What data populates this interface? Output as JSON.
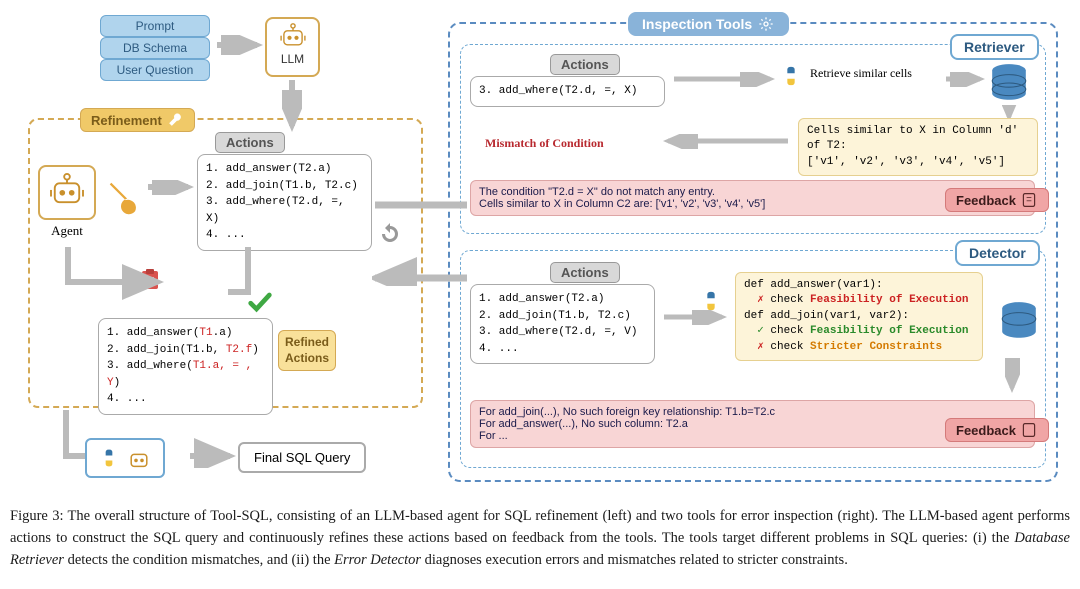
{
  "inputs": {
    "prompt": "Prompt",
    "db": "DB Schema",
    "uq": "User Question"
  },
  "llm_label": "LLM",
  "agent_label": "Agent",
  "refinement_tag": "Refinement",
  "inspection_tag": "Inspection Tools",
  "retriever_tag": "Retriever",
  "detector_tag": "Detector",
  "actions_tag": "Actions",
  "actions_main": [
    "1. add_answer(T2.a)",
    "2. add_join(T1.b, T2.c)",
    "3. add_where(T2.d, =, X)",
    "4. ..."
  ],
  "refined_actions_label": "Refined\nActions",
  "refined_actions": {
    "l1a": "1. add_answer(",
    "l1b": "T1",
    "l1c": ".a)",
    "l2a": "2. add_join(T1.b, ",
    "l2b": "T2.f",
    "l2c": ")",
    "l3a": "3. add_where(",
    "l3b": "T1.a, = , Y",
    "l3c": ")",
    "l4": "4. ..."
  },
  "retriever": {
    "action": "3. add_where(T2.d, =, X)",
    "retrieve_text": "Retrieve similar cells",
    "cells_box": "Cells similar to X in Column 'd' of T2:\n['v1', 'v2', 'v3', 'v4', 'v5']",
    "mismatch": "Mismatch of Condition",
    "feedback": "The condition \"T2.d = X\" do not match any entry.\nCells similar to X in Column C2 are: ['v1', 'v2', 'v3', 'v4', 'v5']"
  },
  "detector": {
    "actions": [
      "1. add_answer(T2.a)",
      "2. add_join(T1.b, T2.c)",
      "3. add_where(T2.d, =, V)",
      "4. ..."
    ],
    "code": {
      "l1": "def add_answer(var1):",
      "l2a": "✗",
      "l2b": " check ",
      "l2c": "Feasibility of Execution",
      "l3": "def add_join(var1, var2):",
      "l4a": "✓",
      "l4b": " check ",
      "l4c": "Feasibility of Execution",
      "l5a": "✗",
      "l5b": " check ",
      "l5c": "Stricter Constraints"
    },
    "feedback": "For add_join(...), No such foreign key relationship: T1.b=T2.c\nFor add_answer(...), No such column: T2.a\nFor ..."
  },
  "feedback_tag": "Feedback",
  "final_query": "Final SQL Query",
  "caption_parts": {
    "p1": "Figure 3: The overall structure of Tool-SQL, consisting of an LLM-based agent for SQL refinement (left) and two tools for error inspection (right). The LLM-based agent performs actions to construct the SQL query and continuously refines these actions based on feedback from the tools. The tools target different problems in SQL queries: (i) the ",
    "p2": "Database Retriever",
    "p3": " detects the condition mismatches, and (ii) the ",
    "p4": "Error Detector",
    "p5": " diagnoses execution errors and mismatches related to stricter constraints."
  }
}
